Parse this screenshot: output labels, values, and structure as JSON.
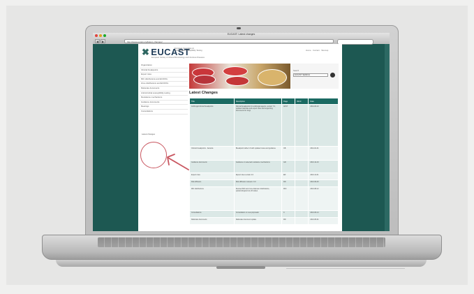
{
  "browser": {
    "window_title": "EUCAST: Latest changes",
    "url": "http://www.eucast.org/latest_changes/",
    "back_label": "◀",
    "forward_label": "▶"
  },
  "site": {
    "logo_mark": "✖",
    "logo_text": "EUCAST",
    "logo_subtitle": "European Committee on Antimicrobial Susceptibility Testing",
    "tagline": "European Society of Clinical Microbiology and Infectious Diseases",
    "top_links": "Home · Contact · Sitemap"
  },
  "sidebar": {
    "items": [
      "Organization",
      "Clinical breakpoints",
      "Expert rules",
      "MIC distributions and ECOFFs",
      "Zone distributions and ECOFFs",
      "Rationale documents",
      "Antimicrobial susceptibility testing",
      "Resistance mechanisms",
      "Guidance documents",
      "Meetings",
      "Consultations"
    ],
    "highlighted": "Latest changes"
  },
  "search": {
    "label": "Search",
    "value": "EUCAST SEARCH"
  },
  "latest": {
    "title": "Latest Changes",
    "columns": [
      "Title",
      "Description",
      "Page",
      "Word",
      "Date"
    ],
    "rows": [
      [
        "Antifungal clinical breakpoints",
        "Clinical breakpoints for antifungal agents, version 7.0, updated rationale and expert rules and supporting documents for fungi",
        "AFST",
        "",
        "2014-03-10"
      ],
      [
        "Clinical breakpoints - bacteria",
        "Breakpoint table 4.0 with updated notes and guidance",
        "CB",
        "",
        "2014-01-01"
      ],
      [
        "Guidance documents",
        "Guidance on selected resistance mechanisms",
        "GD",
        "",
        "2013-12-16"
      ],
      [
        "Expert rules",
        "Expert rules version 2.0",
        "ER",
        "",
        "2013-11-01"
      ],
      [
        "Disk diffusion",
        "Disk diffusion manual v 3.0",
        "DD",
        "",
        "2013-09-03"
      ],
      [
        "MIC distributions",
        "Revised MIC and zone diameter distributions, epidemiological cut-off values",
        "MIC",
        "",
        "2013-08-12"
      ],
      [
        "Consultations",
        "Consultation on new proposals",
        "C",
        "",
        "2013-06-14"
      ],
      [
        "Rationale documents",
        "Rationale document update",
        "RD",
        "",
        "2013-05-01"
      ]
    ]
  },
  "annotation": {
    "circle_color": "#c95660"
  }
}
